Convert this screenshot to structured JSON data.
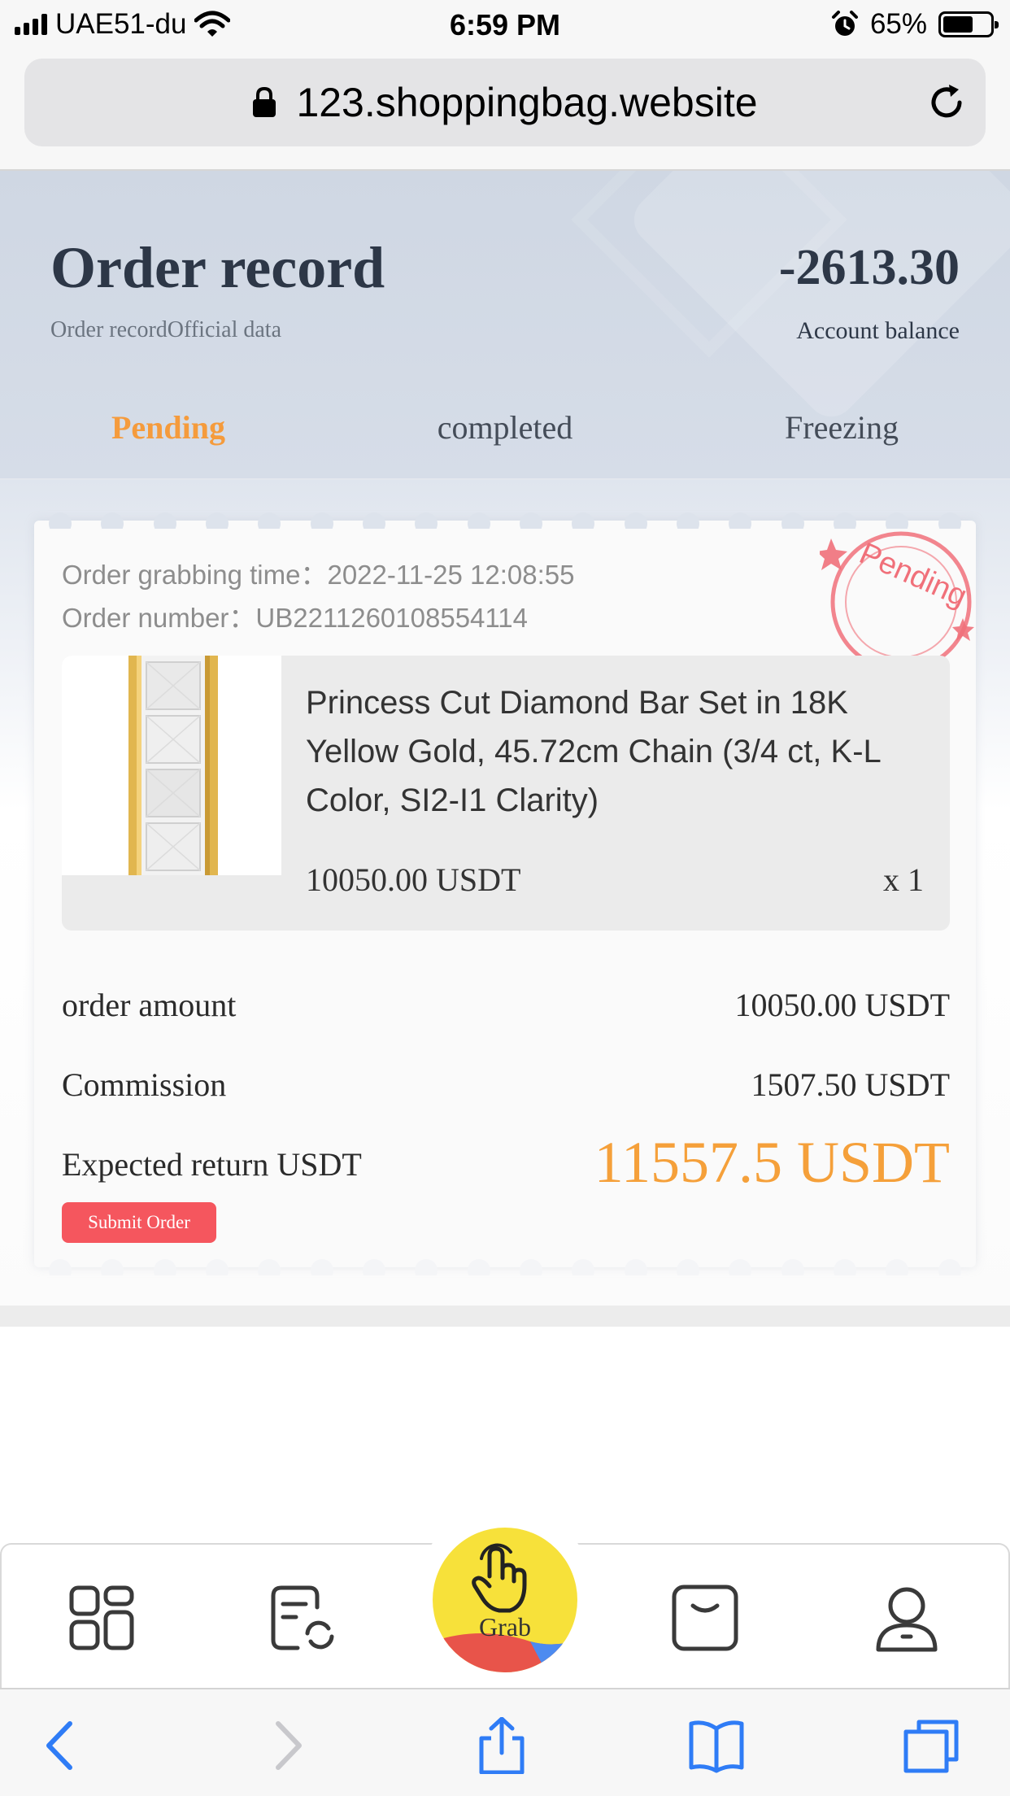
{
  "status_bar": {
    "carrier": "UAE51-du",
    "time": "6:59 PM",
    "battery_percent": "65%",
    "battery_level": 0.65
  },
  "browser": {
    "url": "123.shoppingbag.website"
  },
  "header": {
    "title": "Order record",
    "subtitle": "Order recordOfficial data",
    "balance": "-2613.30",
    "balance_label": "Account balance"
  },
  "tabs": [
    {
      "label": "Pending",
      "active": true
    },
    {
      "label": "completed",
      "active": false
    },
    {
      "label": "Freezing",
      "active": false
    }
  ],
  "order": {
    "grab_time": "Order grabbing time：2022-11-25 12:08:55",
    "order_number": "Order number：UB2211260108554114",
    "stamp_text": "Pending",
    "product": {
      "name": "Princess Cut Diamond Bar Set in 18K Yellow Gold, 45.72cm Chain (3/4 ct, K-L Color, SI2-I1 Clarity)",
      "price": "10050.00 USDT",
      "quantity": "x 1"
    },
    "amount_label": "order amount",
    "amount_value": "10050.00 USDT",
    "commission_label": "Commission",
    "commission_value": "1507.50 USDT",
    "expected_label": "Expected return USDT",
    "expected_value": "11557.5 USDT",
    "submit_label": "Submit Order"
  },
  "bottom_nav": {
    "grab_label": "Grab",
    "items": [
      "apps-icon",
      "records-icon",
      "grab-hand-icon",
      "wallet-icon",
      "profile-icon"
    ]
  },
  "colors": {
    "accent_orange": "#f59b3c",
    "submit_red": "#f5565e",
    "grab_yellow": "#f7e13a",
    "safari_blue": "#2f7cf6",
    "stamp_red": "#f0707a"
  }
}
